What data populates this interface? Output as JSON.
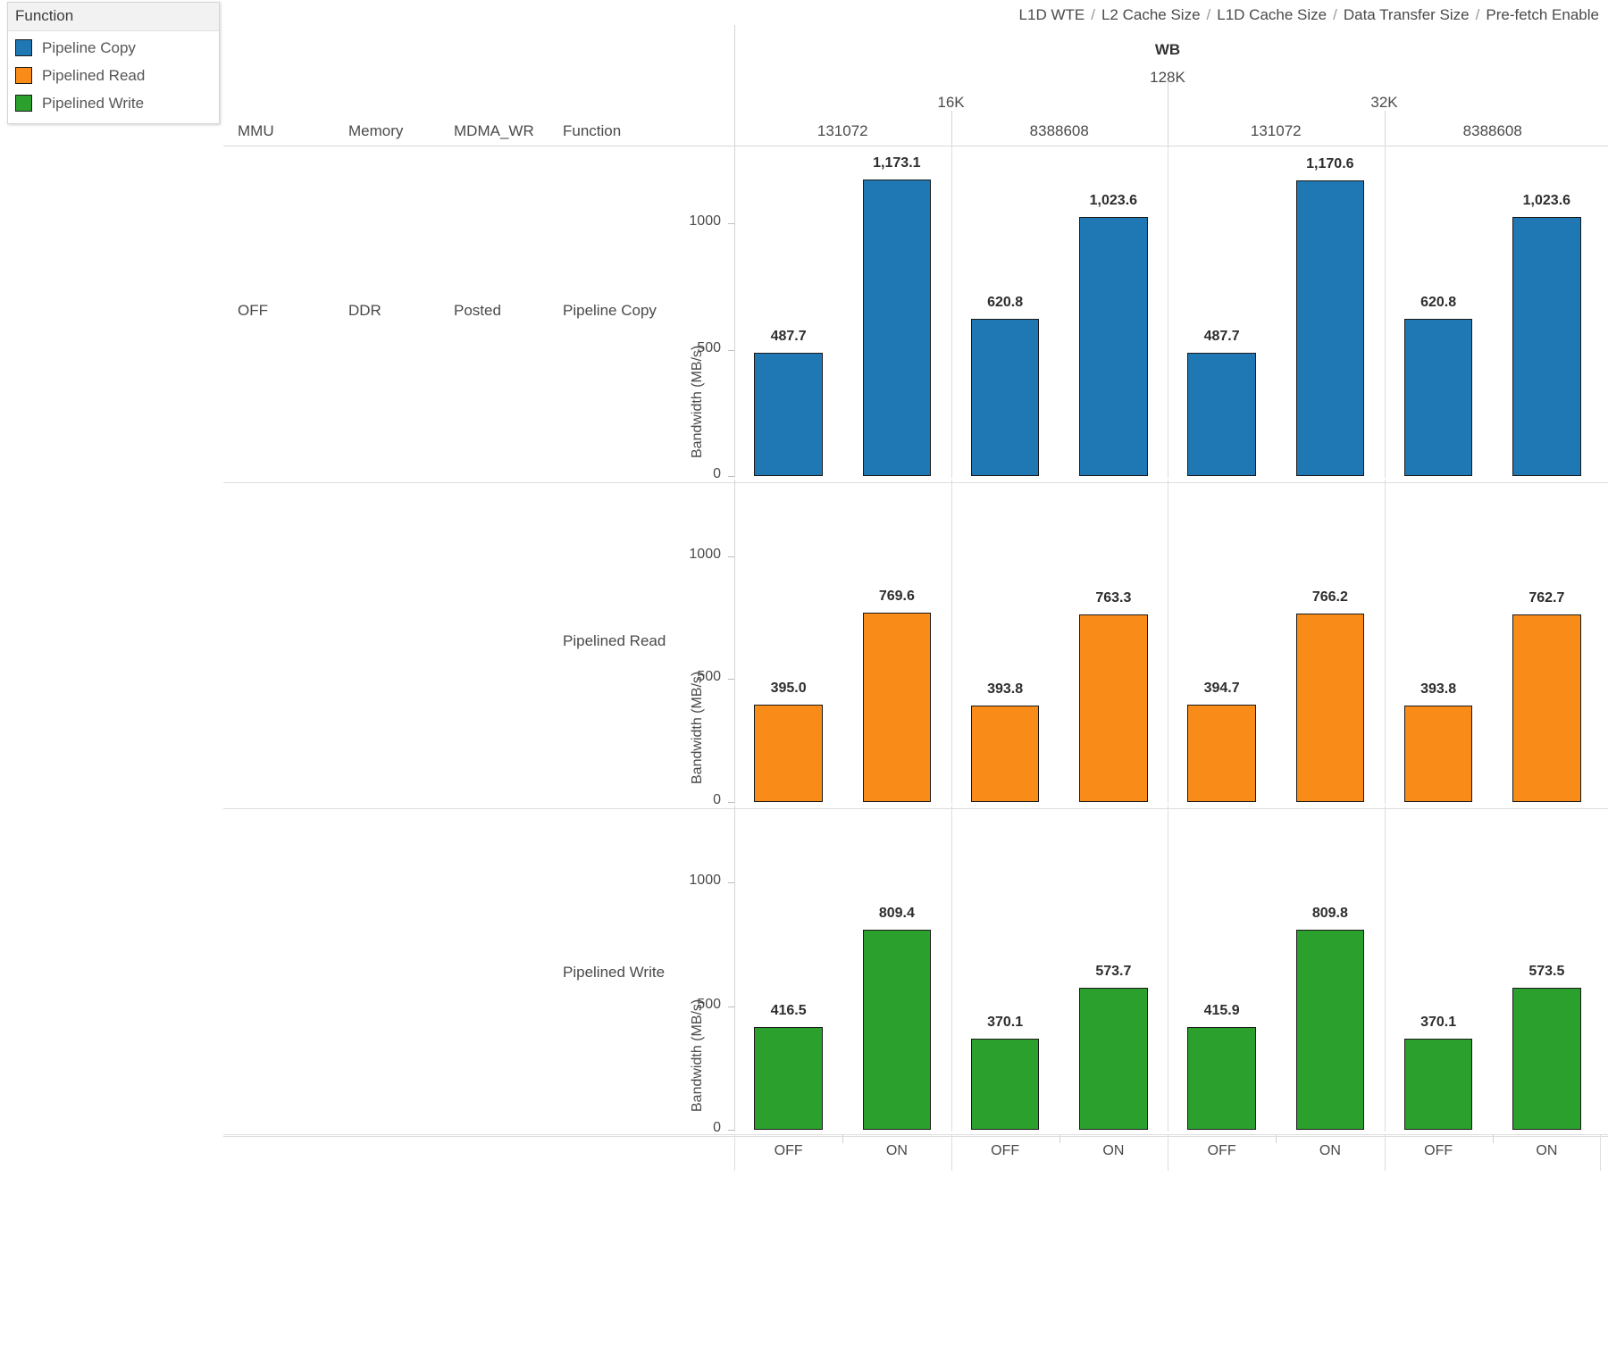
{
  "legend": {
    "title": "Function",
    "items": [
      {
        "label": "Pipeline Copy",
        "color": "#1f78b4"
      },
      {
        "label": "Pipelined Read",
        "color": "#f98b18"
      },
      {
        "label": "Pipelined Write",
        "color": "#2ca02c"
      }
    ]
  },
  "breadcrumb": {
    "parts": [
      "L1D WTE",
      "L2 Cache Size",
      "L1D Cache Size",
      "Data Transfer Size",
      "Pre-fetch Enable"
    ],
    "separator": "/"
  },
  "column_headers": {
    "l1d_wte": "WB",
    "l2_cache_size": "128K",
    "l1d_cache_size": [
      "16K",
      "32K"
    ],
    "data_transfer_size": [
      "131072",
      "8388608",
      "131072",
      "8388608"
    ]
  },
  "row_header_labels": [
    "MMU",
    "Memory",
    "MDMA_WR",
    "Function"
  ],
  "row_dimensions": {
    "mmu": "OFF",
    "memory": "DDR",
    "mdma_wr": "Posted"
  },
  "row_labels": [
    "Pipeline Copy",
    "Pipelined Read",
    "Pipelined Write"
  ],
  "axis": {
    "ylabel": "Bandwidth (MB/s)",
    "yticks": [
      "0",
      "500",
      "1000"
    ],
    "ytick_values": [
      0,
      500,
      1000
    ],
    "ymax": 1290,
    "xticks": [
      "OFF",
      "ON"
    ]
  },
  "chart_data": {
    "type": "bar",
    "title": "",
    "xlabel": "Pre-fetch Enable",
    "ylabel": "Bandwidth (MB/s)",
    "ylim": [
      0,
      1290
    ],
    "grid": false,
    "legend_position": "top-left",
    "facet_columns": [
      {
        "l1d_cache_size": "16K",
        "data_transfer_size": "131072"
      },
      {
        "l1d_cache_size": "16K",
        "data_transfer_size": "8388608"
      },
      {
        "l1d_cache_size": "32K",
        "data_transfer_size": "131072"
      },
      {
        "l1d_cache_size": "32K",
        "data_transfer_size": "8388608"
      }
    ],
    "facet_rows": [
      "Pipeline Copy",
      "Pipelined Read",
      "Pipelined Write"
    ],
    "categories": [
      "OFF",
      "ON"
    ],
    "series": [
      {
        "name": "Pipeline Copy",
        "color": "#1f78b4",
        "cells": [
          {
            "facet": 0,
            "values": [
              487.7,
              1173.1
            ],
            "labels": [
              "487.7",
              "1,173.1"
            ]
          },
          {
            "facet": 1,
            "values": [
              620.8,
              1023.6
            ],
            "labels": [
              "620.8",
              "1,023.6"
            ]
          },
          {
            "facet": 2,
            "values": [
              487.7,
              1170.6
            ],
            "labels": [
              "487.7",
              "1,170.6"
            ]
          },
          {
            "facet": 3,
            "values": [
              620.8,
              1023.6
            ],
            "labels": [
              "620.8",
              "1,023.6"
            ]
          }
        ]
      },
      {
        "name": "Pipelined Read",
        "color": "#f98b18",
        "cells": [
          {
            "facet": 0,
            "values": [
              395.0,
              769.6
            ],
            "labels": [
              "395.0",
              "769.6"
            ]
          },
          {
            "facet": 1,
            "values": [
              393.8,
              763.3
            ],
            "labels": [
              "393.8",
              "763.3"
            ]
          },
          {
            "facet": 2,
            "values": [
              394.7,
              766.2
            ],
            "labels": [
              "394.7",
              "766.2"
            ]
          },
          {
            "facet": 3,
            "values": [
              393.8,
              762.7
            ],
            "labels": [
              "393.8",
              "762.7"
            ]
          }
        ]
      },
      {
        "name": "Pipelined Write",
        "color": "#2ca02c",
        "cells": [
          {
            "facet": 0,
            "values": [
              416.5,
              809.4
            ],
            "labels": [
              "416.5",
              "809.4"
            ]
          },
          {
            "facet": 1,
            "values": [
              370.1,
              573.7
            ],
            "labels": [
              "370.1",
              "573.7"
            ]
          },
          {
            "facet": 2,
            "values": [
              415.9,
              809.8
            ],
            "labels": [
              "415.9",
              "809.8"
            ]
          },
          {
            "facet": 3,
            "values": [
              370.1,
              573.5
            ],
            "labels": [
              "370.1",
              "573.5"
            ]
          }
        ]
      }
    ]
  }
}
